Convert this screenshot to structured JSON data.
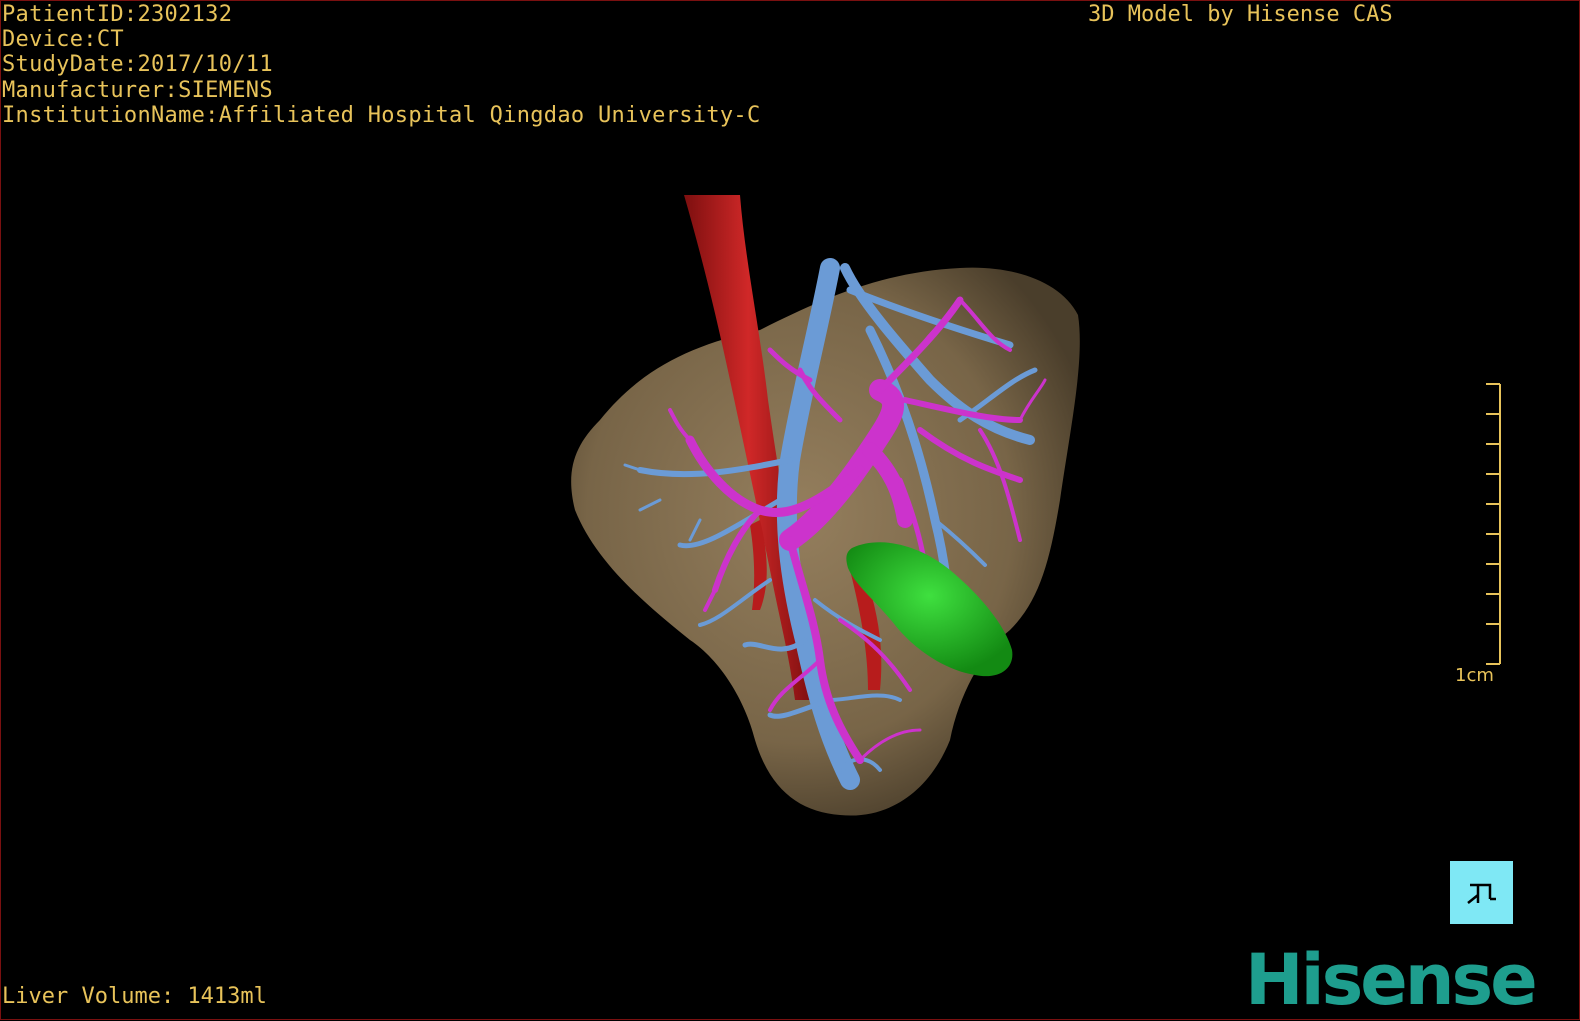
{
  "header": {
    "patient_id": "PatientID:2302132",
    "device": "Device:CT",
    "study_date": "StudyDate:2017/10/11",
    "manufacturer": "Manufacturer:SIEMENS",
    "institution": "InstitutionName:Affiliated Hospital Qingdao University-C",
    "model_credit": "3D Model by Hisense CAS"
  },
  "footer": {
    "liver_volume": "Liver Volume: 1413ml"
  },
  "scale_bar": {
    "label": "1cm"
  },
  "logo": {
    "text": "Hisense"
  },
  "orientation_button": {
    "icon": "orientation-figure-icon"
  },
  "colors": {
    "overlay_text": "#e8c35a",
    "liver": "#8a7453",
    "artery": "#b71c1c",
    "portal_vein": "#cc33cc",
    "hepatic_vein": "#6b9bd6",
    "gallbladder": "#1fb91f",
    "brand": "#1e9e8e",
    "button_bg": "#7fe8f5"
  }
}
